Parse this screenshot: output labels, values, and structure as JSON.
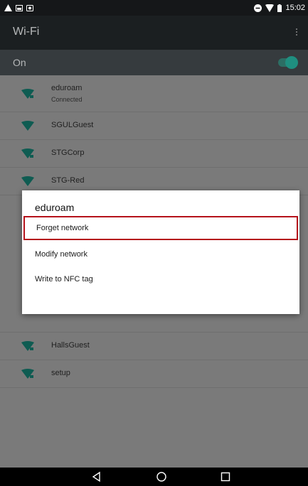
{
  "status_bar": {
    "time": "15:02",
    "icons": [
      "warning-icon",
      "image-icon",
      "screenshot-icon",
      "dnd-icon",
      "wifi-signal-icon",
      "battery-icon"
    ]
  },
  "action_bar": {
    "title": "Wi-Fi",
    "overflow_icon": "more-vert-icon"
  },
  "switch_bar": {
    "label": "On",
    "enabled": true
  },
  "networks": [
    {
      "name": "eduroam",
      "status": "Connected",
      "secured": true
    },
    {
      "name": "SGULGuest",
      "status": "",
      "secured": false
    },
    {
      "name": "STGCorp",
      "status": "",
      "secured": true
    },
    {
      "name": "STG-Red",
      "status": "",
      "secured": false
    },
    {
      "name": "HallsGuest",
      "status": "",
      "secured": true
    },
    {
      "name": "setup",
      "status": "",
      "secured": true
    }
  ],
  "dialog": {
    "title": "eduroam",
    "options": [
      "Forget network",
      "Modify network",
      "Write to NFC tag"
    ],
    "highlighted_option": "Forget network"
  },
  "nav_bar": {
    "back_icon": "back-icon",
    "home_icon": "home-icon",
    "recents_icon": "recents-icon"
  },
  "colors": {
    "accent": "#1f8f80",
    "highlight_border": "#b5121b"
  }
}
